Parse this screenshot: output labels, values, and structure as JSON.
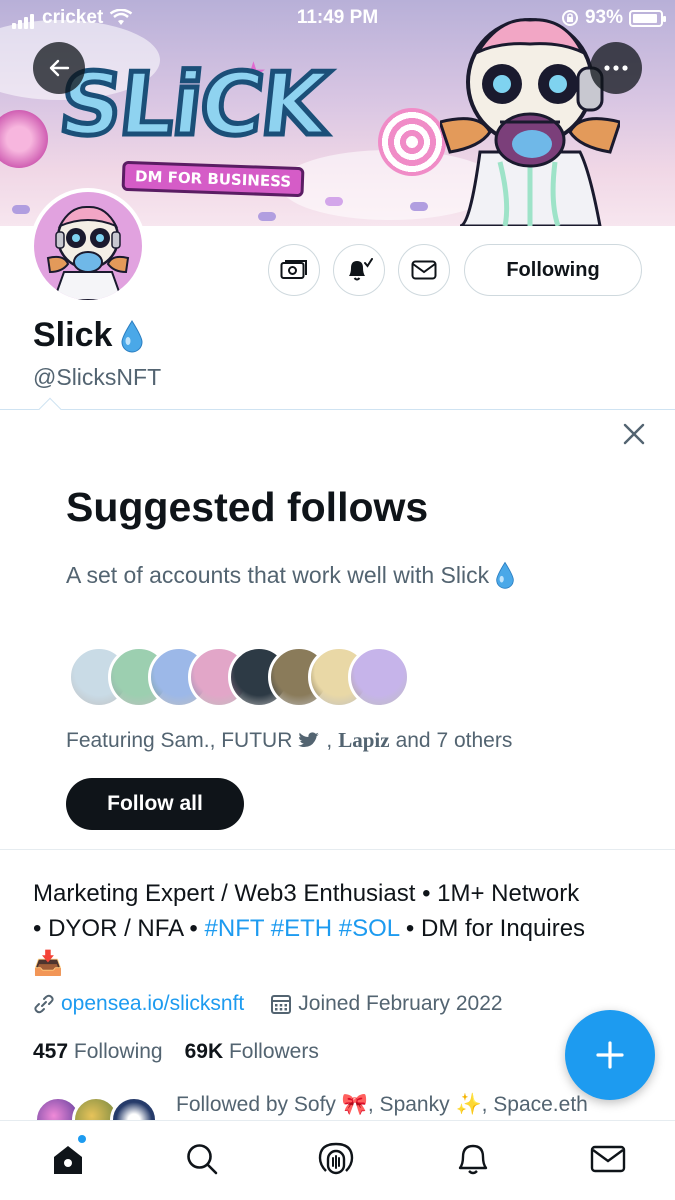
{
  "status_bar": {
    "carrier": "cricket",
    "time": "11:49 PM",
    "battery": "93%"
  },
  "banner": {
    "logo_text": "SLiCK",
    "logo_tagline": "DM FOR BUSINESS"
  },
  "profile": {
    "name": "Slick",
    "handle": "@SlicksNFT",
    "following_button": "Following",
    "badge_emoji": "💧"
  },
  "suggested": {
    "title": "Suggested follows",
    "subtitle": "A set of accounts that work well with Slick",
    "featuring_prefix": "Featuring Sam., FUTUR",
    "featuring_lapiz": "Lapiz",
    "featuring_suffix": "and 7 others",
    "follow_all": "Follow all",
    "face_colors": [
      "#c9dbe6",
      "#9ccfb0",
      "#9cb8e8",
      "#e2a6c8",
      "#2d3a45",
      "#8a7b5a",
      "#e9d8a6",
      "#c6b4ea"
    ]
  },
  "bio": {
    "line1": "Marketing Expert / Web3 Enthusiast • 1M+ Network",
    "line2_a": "• DYOR / NFA • ",
    "line2_tags": "#NFT #ETH #SOL",
    "line2_b": " • DM for Inquires",
    "inbox_emoji": "📥"
  },
  "meta": {
    "link": "opensea.io/slicksnft",
    "joined": "Joined February 2022"
  },
  "stats": {
    "following_count": "457",
    "following_label": "Following",
    "followers_count": "69K",
    "followers_label": "Followers"
  },
  "followed_by": {
    "text": "Followed by Sofy 🎀, Spanky ✨, Space.eth"
  },
  "tabs": [
    "home",
    "search",
    "spaces",
    "notifications",
    "messages"
  ],
  "colors": {
    "accent": "#1d9bf0",
    "text": "#0f1419",
    "secondary": "#536471"
  }
}
